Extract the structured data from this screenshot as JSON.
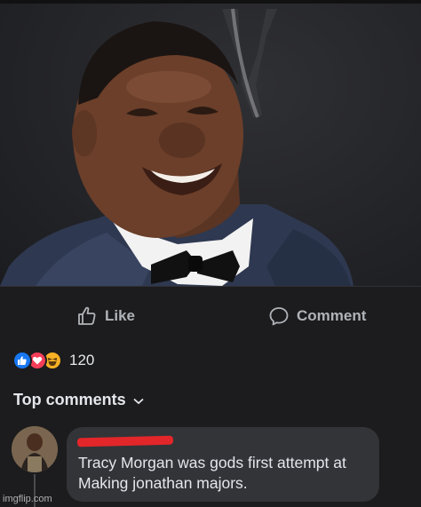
{
  "post": {
    "photo": {
      "subject": "smiling man in tuxedo"
    }
  },
  "actions": {
    "like_label": "Like",
    "comment_label": "Comment"
  },
  "reactions": {
    "types": [
      "like",
      "love",
      "haha"
    ],
    "count": "120"
  },
  "comments": {
    "section_label": "Top comments",
    "items": [
      {
        "text": "Tracy Morgan was gods first attempt at Making jonathan majors."
      }
    ]
  },
  "watermark": "imgflip.com",
  "colors": {
    "background": "#1c1c1e",
    "bubble": "#333438",
    "like_blue": "#1877f2",
    "love_red": "#f33e58",
    "haha_yellow": "#f7b125",
    "redaction": "#e2262a"
  }
}
